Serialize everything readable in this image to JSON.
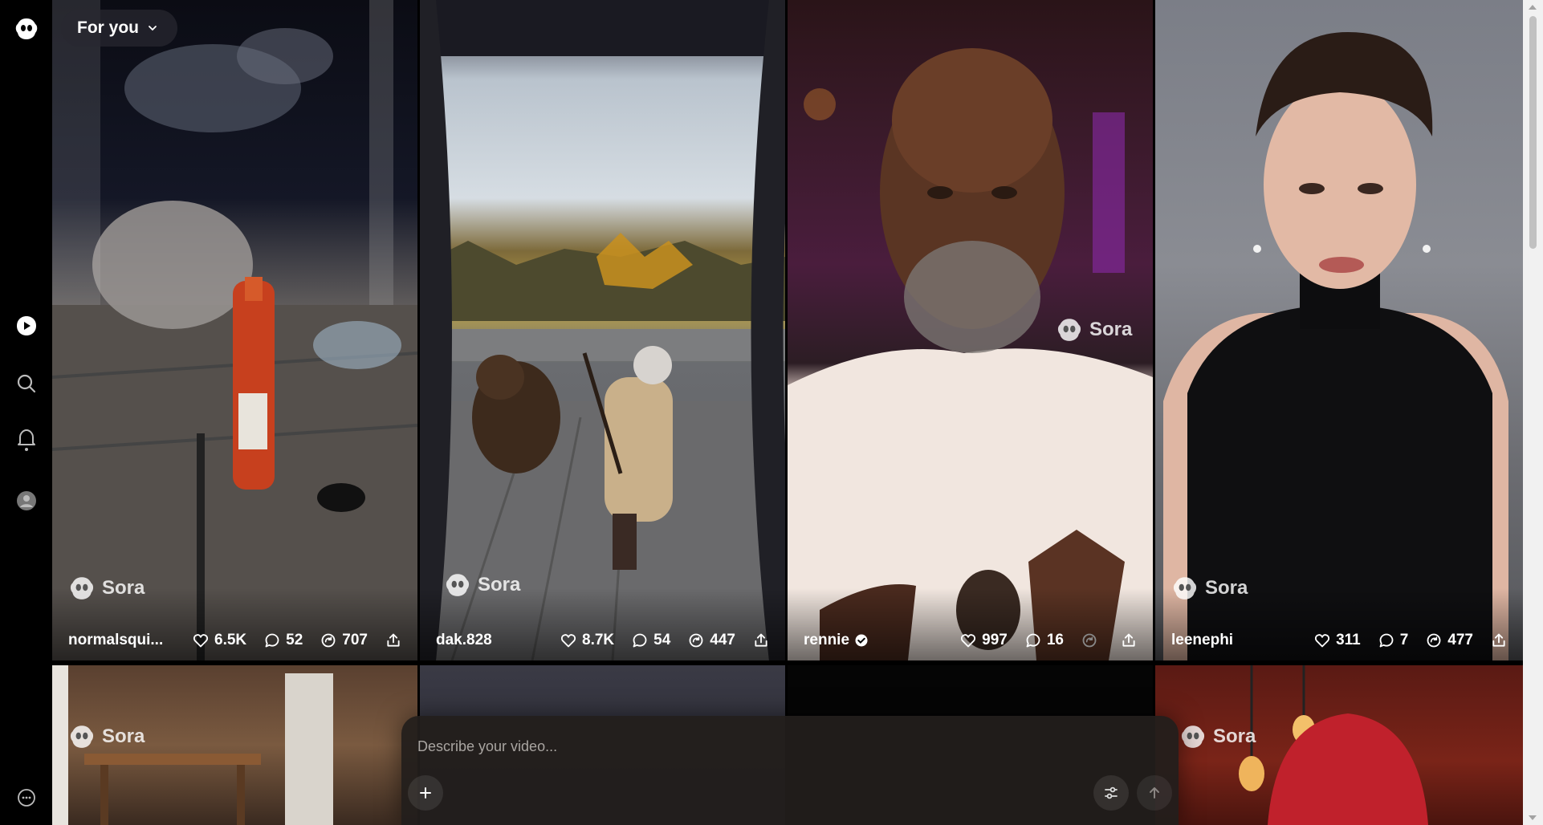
{
  "feed_selector": {
    "label": "For you"
  },
  "sidebar": {
    "items": [
      {
        "name": "sora-logo-icon"
      },
      {
        "name": "video-icon"
      },
      {
        "name": "search-icon"
      },
      {
        "name": "bell-icon"
      },
      {
        "name": "profile-icon"
      },
      {
        "name": "more-icon"
      }
    ]
  },
  "watermark": "Sora",
  "videos": [
    {
      "user": "normalsqui...",
      "likes": "6.5K",
      "comments": "52",
      "remixes": "707",
      "verified": false
    },
    {
      "user": "dak.828",
      "likes": "8.7K",
      "comments": "54",
      "remixes": "447",
      "verified": false
    },
    {
      "user": "rennie",
      "likes": "997",
      "comments": "16",
      "remixes": "",
      "verified": true
    },
    {
      "user": "leenephi",
      "likes": "311",
      "comments": "7",
      "remixes": "477",
      "verified": false
    }
  ],
  "composer": {
    "placeholder": "Describe your video..."
  },
  "colors": {
    "background": "#000000",
    "composer": "#221e1c",
    "accent": "#ffffff"
  }
}
